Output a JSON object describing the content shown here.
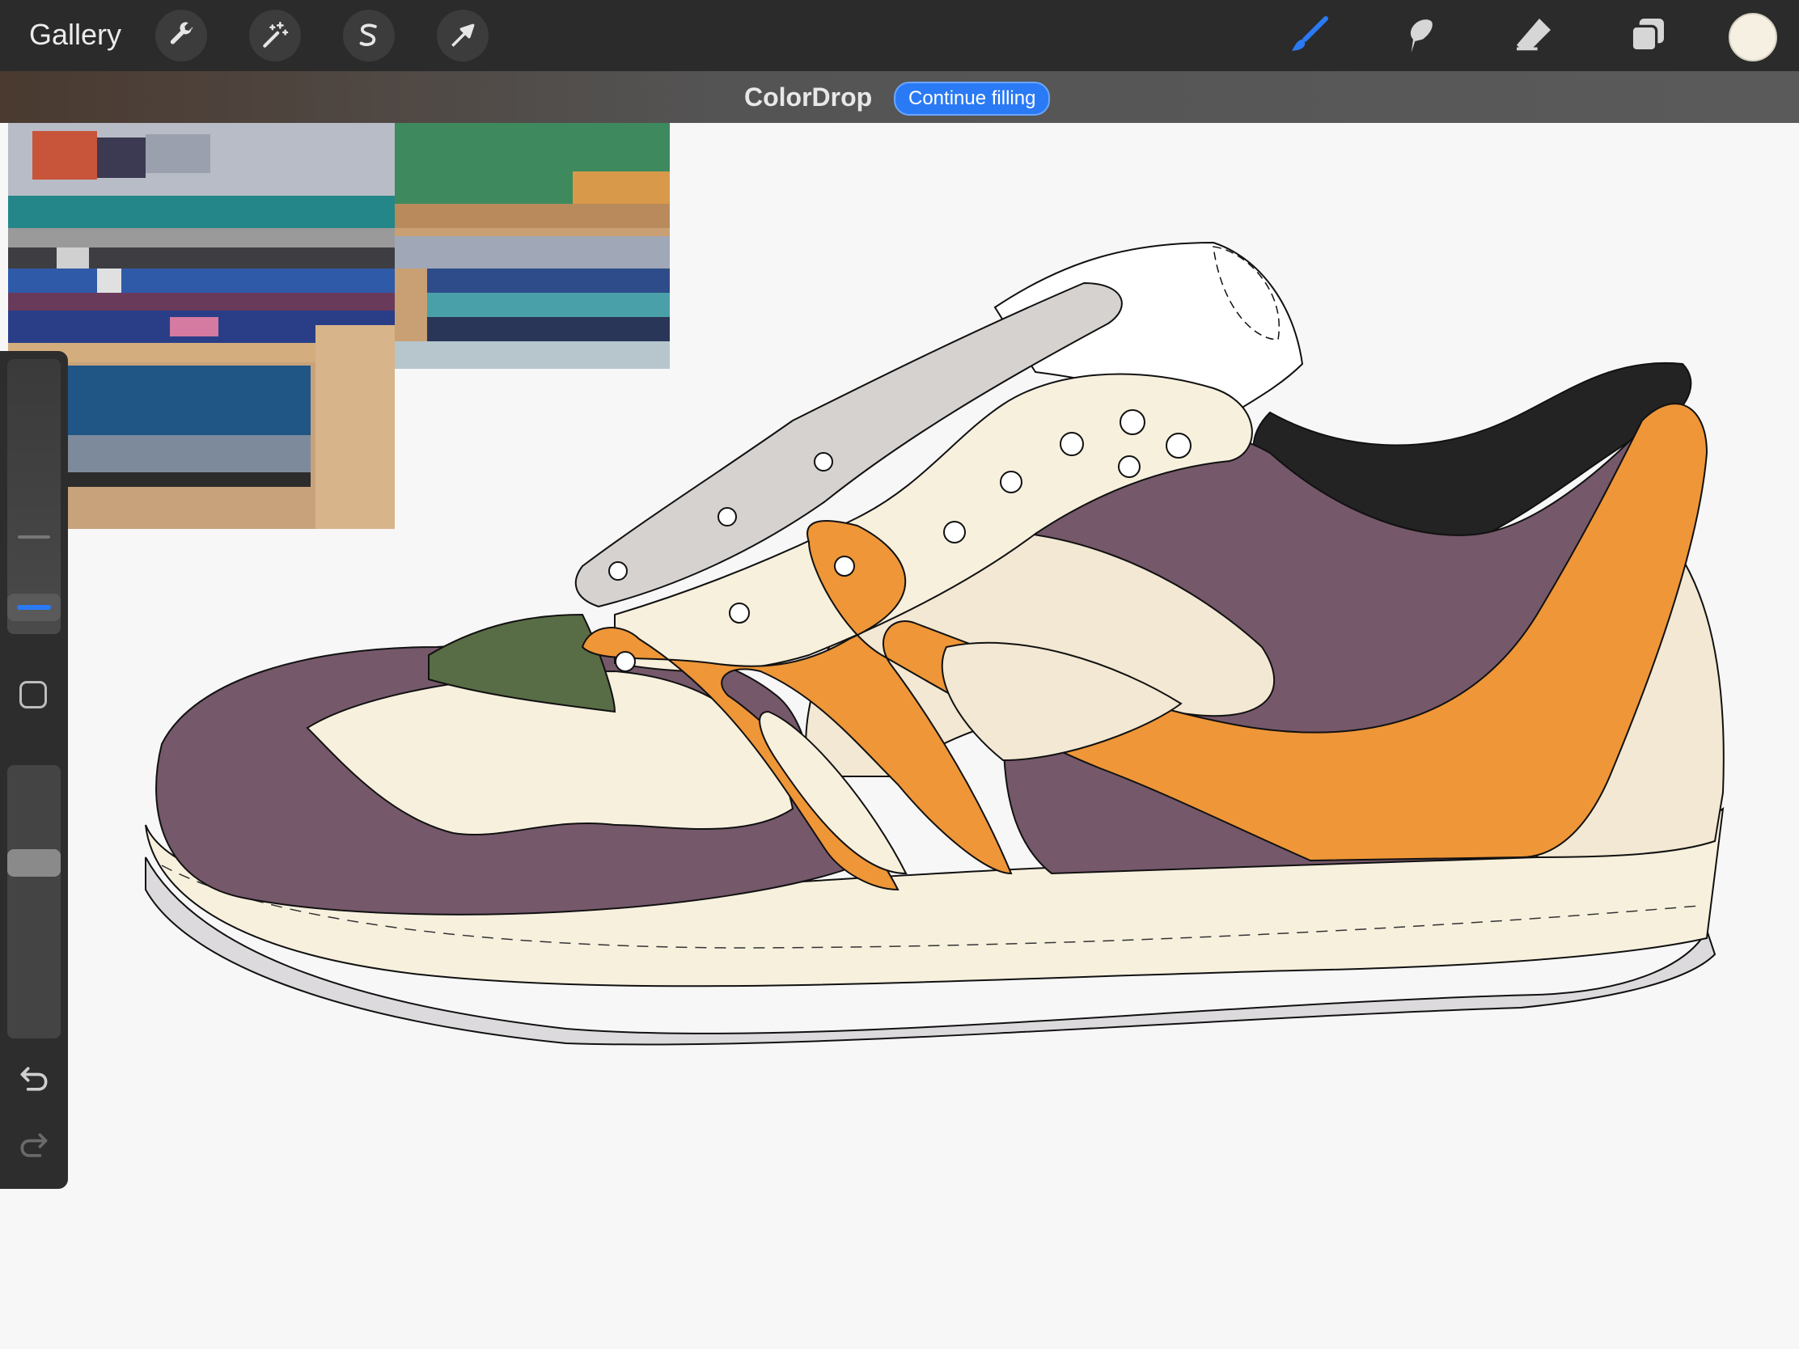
{
  "toolbar": {
    "gallery_label": "Gallery",
    "left_tools": [
      "wrench-icon",
      "magic-wand-icon",
      "selection-s-icon",
      "arrow-transform-icon"
    ],
    "right_tools": [
      "brush-icon",
      "smudge-icon",
      "eraser-icon",
      "layers-icon"
    ],
    "active_tool": "brush-icon",
    "accent_color": "#2a7af5",
    "current_color": "#f6f0e2"
  },
  "notification": {
    "title": "ColorDrop",
    "button_label": "Continue filling"
  },
  "sidebar": {
    "tools": [
      "brush-size-slider",
      "modify-button",
      "opacity-slider",
      "undo-icon",
      "redo-icon"
    ]
  },
  "canvas": {
    "colors": {
      "purple": "#75586a",
      "orange": "#ee9638",
      "cream": "#f7f0dd",
      "cream_dark": "#f2e8d3",
      "lace_gray": "#d5d2cf",
      "green": "#586d45",
      "black": "#232323"
    }
  }
}
